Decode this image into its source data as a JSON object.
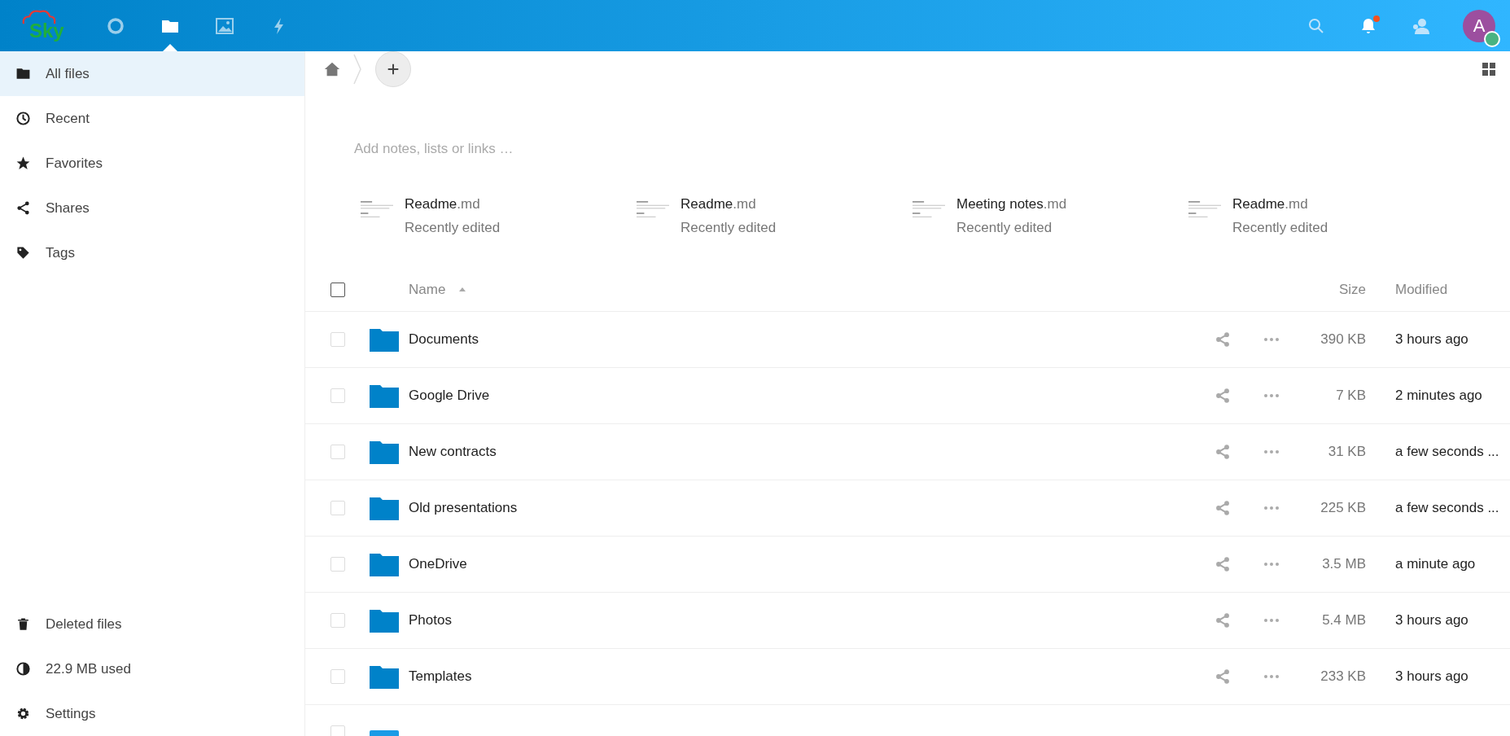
{
  "header": {
    "logo_text": "Sky",
    "apps": [
      {
        "selected": false
      },
      {
        "selected": true
      },
      {
        "selected": false
      },
      {
        "selected": false
      }
    ],
    "notifications": {
      "unread": true
    },
    "avatar": {
      "letter": "A",
      "online": true
    }
  },
  "sidebar": {
    "items": [
      {
        "label": "All files",
        "selected": true
      },
      {
        "label": "Recent",
        "selected": false
      },
      {
        "label": "Favorites",
        "selected": false
      },
      {
        "label": "Shares",
        "selected": false
      },
      {
        "label": "Tags",
        "selected": false
      }
    ],
    "footer": [
      {
        "label": "Deleted files"
      },
      {
        "label": "22.9 MB used"
      },
      {
        "label": "Settings"
      }
    ]
  },
  "notes": {
    "placeholder": "Add notes, lists or links …"
  },
  "recent": [
    {
      "name": "Readme",
      "ext": ".md",
      "status": "Recently edited"
    },
    {
      "name": "Readme",
      "ext": ".md",
      "status": "Recently edited"
    },
    {
      "name": "Meeting notes",
      "ext": ".md",
      "status": "Recently edited"
    },
    {
      "name": "Readme",
      "ext": ".md",
      "status": "Recently edited"
    }
  ],
  "table": {
    "select_all": {
      "checked": false
    },
    "columns": [
      {
        "label": "Name",
        "sorted_ascending": true
      },
      {
        "label": "Size"
      },
      {
        "label": "Modified"
      }
    ],
    "rows": [
      {
        "kind": "folder",
        "name": "Documents",
        "size": "390 KB",
        "modified": "3 hours ago",
        "checked": false
      },
      {
        "kind": "folder",
        "name": "Google Drive",
        "size": "7 KB",
        "modified": "2 minutes ago",
        "checked": false
      },
      {
        "kind": "folder",
        "name": "New contracts",
        "size": "31 KB",
        "modified": "a few seconds ...",
        "checked": false
      },
      {
        "kind": "folder",
        "name": "Old presentations",
        "size": "225 KB",
        "modified": "a few seconds ...",
        "checked": false
      },
      {
        "kind": "folder",
        "name": "OneDrive",
        "size": "3.5 MB",
        "modified": "a minute ago",
        "checked": false
      },
      {
        "kind": "folder",
        "name": "Photos",
        "size": "5.4 MB",
        "modified": "3 hours ago",
        "checked": false
      },
      {
        "kind": "folder",
        "name": "Templates",
        "size": "233 KB",
        "modified": "3 hours ago",
        "checked": false
      },
      {
        "kind": "image",
        "checked": false
      }
    ]
  }
}
